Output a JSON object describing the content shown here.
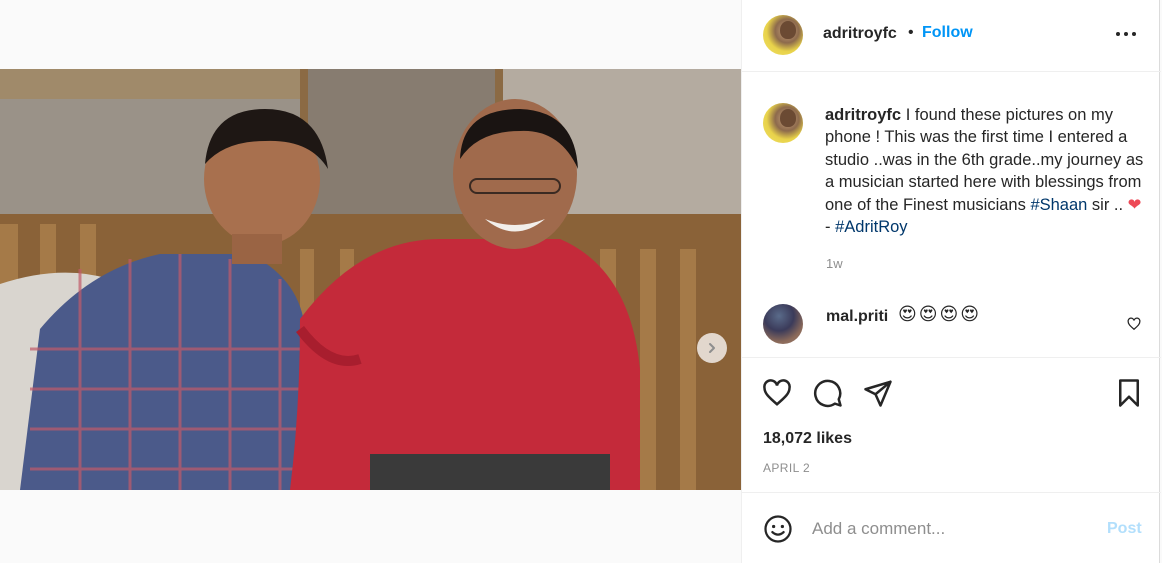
{
  "post": {
    "username": "adritroyfc",
    "separator": "•",
    "follow_label": "Follow",
    "more_icon": "more-horizontal-icon"
  },
  "caption": {
    "username": "adritroyfc",
    "text_part1": " I found these pictures on my phone ! This was the first time I entered a studio ..was in the 6th grade..my journey as a musician started here with blessings from one of the Finest musicians ",
    "hashtag1": "#Shaan",
    "text_part2": " sir .. ",
    "heart": "❤",
    "text_part3": "  - ",
    "hashtag2": "#AdritRoy",
    "time_ago": "1w"
  },
  "comment": {
    "username": "mal.priti",
    "text": "😍😍😍😍",
    "cut_text": "· ·  · ·"
  },
  "engagement": {
    "likes": "18,072 likes",
    "date": "APRIL 2"
  },
  "comment_box": {
    "placeholder": "Add a comment...",
    "post_label": "Post"
  },
  "carousel": {
    "total_slides": 2,
    "active_slide": 1
  },
  "colors": {
    "follow_blue": "#0095f6",
    "hashtag": "#00376b",
    "post_disabled": "#b2dffc",
    "heart_red": "#ed4956"
  }
}
